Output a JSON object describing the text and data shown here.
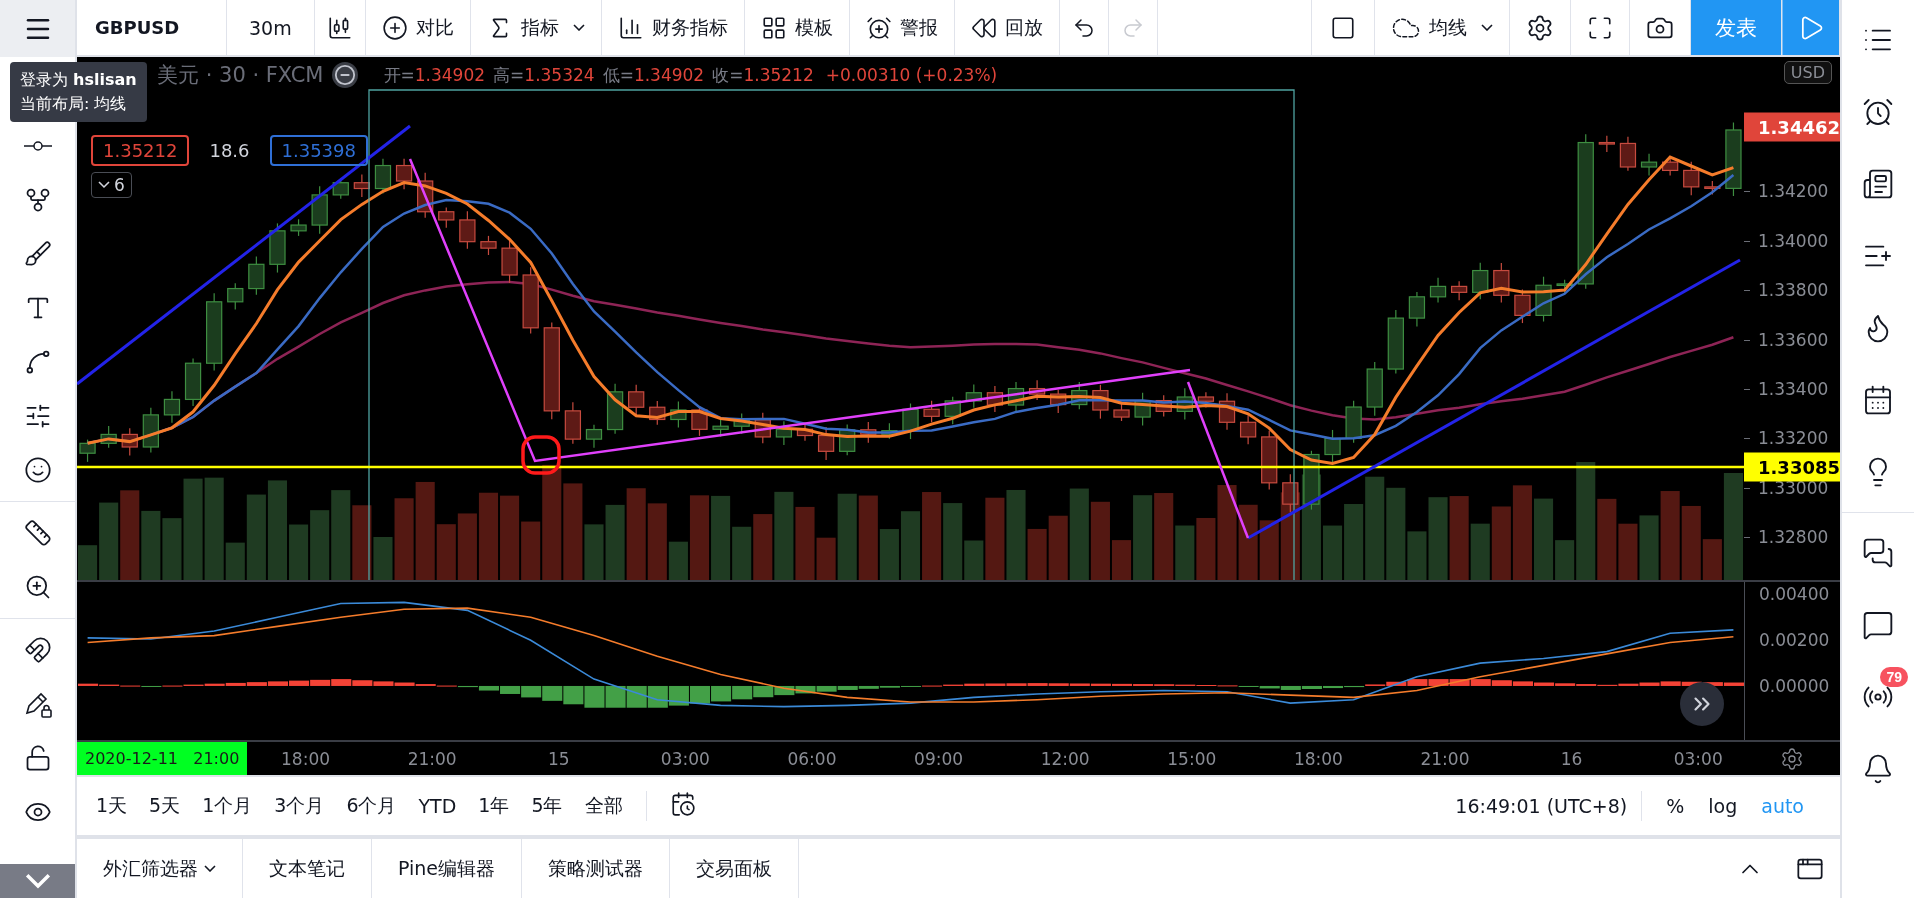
{
  "top_toolbar": {
    "symbol": "GBPUSD",
    "interval": "30m",
    "buttons": [
      {
        "kind": "compare",
        "label": "对比"
      },
      {
        "kind": "indicators",
        "label": "指标"
      },
      {
        "kind": "financials",
        "label": "财务指标"
      },
      {
        "kind": "templates",
        "label": "模板"
      },
      {
        "kind": "alert",
        "label": "警报"
      },
      {
        "kind": "replay",
        "label": "回放"
      }
    ],
    "undo": {
      "disabled": false
    },
    "redo": {
      "disabled": true
    },
    "layout": "均线",
    "publish": "发表"
  },
  "tooltip": {
    "lines": [
      "登录为 **hslisan**",
      "当前布局: 均线"
    ]
  },
  "legend": {
    "title": "美元 · 30 · FXCM",
    "ohlc": [
      {
        "label": "开=",
        "value": "1.34902"
      },
      {
        "label": "高=",
        "value": "1.35324"
      },
      {
        "label": "低=",
        "value": "1.34902"
      },
      {
        "label": "收=",
        "value": "1.35212"
      }
    ],
    "change": "+0.00310 (+0.23%)",
    "indicator_values": [
      {
        "kind": "boxed",
        "value": "1.35212",
        "color": "#e0453a"
      },
      {
        "kind": "plain",
        "value": "18.6"
      },
      {
        "kind": "boxed",
        "value": "1.35398",
        "color": "#2f6fd6"
      }
    ],
    "collapsed_count": "6"
  },
  "price_axis": {
    "currency": "USD",
    "ticks": [
      "1.34200",
      "1.34000",
      "1.33800",
      "1.33600",
      "1.33400",
      "1.33200",
      "1.33000",
      "1.32800"
    ],
    "labels": [
      {
        "value": "1.34462",
        "color": "#e0453a"
      },
      {
        "value": "1.33085",
        "color": "#ffff00"
      }
    ]
  },
  "macd_pane": {
    "chart_data": {
      "type": "line",
      "series": [
        {
          "color": "#3b8ad8",
          "values": [
            0.0021,
            0.00205,
            0.0024,
            0.003,
            0.0036,
            0.00365,
            0.0033,
            0.002,
            0.0003,
            -0.0006,
            -0.00085,
            -0.0009,
            -0.00085,
            -0.00075,
            -0.0005,
            -0.00035,
            -0.00025,
            -0.0002,
            -0.00025,
            -0.00075,
            -0.0006,
            0.0004,
            0.001,
            0.0012,
            0.0015,
            0.0023,
            0.00245
          ]
        },
        {
          "color": "#f57c2b",
          "values": [
            0.0019,
            0.0021,
            0.0022,
            0.0026,
            0.003,
            0.00335,
            0.0034,
            0.003,
            0.0022,
            0.0013,
            0.0005,
            -0.0001,
            -0.0005,
            -0.0007,
            -0.0007,
            -0.0006,
            -0.00045,
            -0.00035,
            -0.0003,
            -0.0004,
            -0.0005,
            -0.0002,
            0.0004,
            0.0009,
            0.0014,
            0.0019,
            0.00215
          ]
        }
      ],
      "ylim": [
        -0.00236,
        0.00454
      ],
      "yticks": [
        {
          "value": 0.004,
          "label": "0.00400"
        },
        {
          "value": 0.002,
          "label": "0.00200"
        },
        {
          "value": 0,
          "label": "0.00000"
        }
      ]
    }
  },
  "time_axis": {
    "date_badge": "2020-12-11   21:00",
    "ticks": [
      "18:00",
      "21:00",
      "15",
      "03:00",
      "06:00",
      "09:00",
      "12:00",
      "15:00",
      "18:00",
      "21:00",
      "16",
      "03:00"
    ]
  },
  "range_bar": {
    "ranges": [
      "1天",
      "5天",
      "1个月",
      "3个月",
      "6个月",
      "YTD",
      "1年",
      "5年",
      "全部"
    ],
    "clock": "16:49:01 (UTC+8)",
    "scale_options": [
      {
        "label": "%",
        "selected": false
      },
      {
        "label": "log",
        "selected": false
      },
      {
        "label": "auto",
        "selected": true
      }
    ]
  },
  "bottom_tabs": [
    {
      "kind": "dropdown",
      "label": "外汇筛选器"
    },
    {
      "kind": "plain",
      "label": "文本笔记"
    },
    {
      "kind": "plain",
      "label": "Pine编辑器"
    },
    {
      "kind": "plain",
      "label": "策略测试器"
    },
    {
      "kind": "plain",
      "label": "交易面板"
    }
  ],
  "sidebar": {
    "notifications_badge": "79"
  }
}
